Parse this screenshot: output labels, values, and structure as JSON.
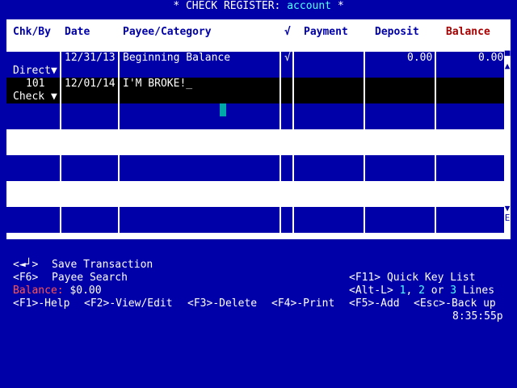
{
  "title": {
    "prefix": "* CHECK REGISTER: ",
    "account": "account",
    "suffix": " *"
  },
  "columns": [
    "Chk/By",
    "Date",
    "Payee/Category",
    "√",
    "Payment",
    "Deposit",
    "Balance"
  ],
  "rows": [
    {
      "num": "",
      "type": "Direct▼",
      "date": "12/31/13",
      "payee": "Beginning Balance",
      "cleared": "√",
      "payment": "",
      "deposit": "0.00",
      "balance": "0.00"
    },
    {
      "num": "101",
      "type": "Check ▼",
      "date": "12/01/14",
      "payee": "I'M BROKE!_",
      "cleared": "",
      "payment": "",
      "deposit": "",
      "balance": ""
    }
  ],
  "scroll": {
    "up": "▲",
    "down": "▼",
    "end": "E",
    "top_mark": "▀"
  },
  "help": {
    "save_key": "<◄┘>",
    "save_label": "Save Transaction",
    "search_key": "<F6>",
    "search_label": "Payee Search",
    "quickkey": "<F11> Quick Key List",
    "lines_key": "<Alt-L>",
    "lines_1": "1",
    "lines_sep1": ", ",
    "lines_2": "2",
    "lines_sep2": " or ",
    "lines_3": "3",
    "lines_label": " Lines",
    "balance_label": "Balance:",
    "balance_value": " $0.00"
  },
  "fkeys": [
    {
      "key": "<F1>",
      "label": "-Help"
    },
    {
      "key": "<F2>",
      "label": "-View/Edit"
    },
    {
      "key": "<F3>",
      "label": "-Delete"
    },
    {
      "key": "<F4>",
      "label": "-Print"
    },
    {
      "key": "<F5>",
      "label": "-Add"
    },
    {
      "key": "<Esc>",
      "label": "-Back up"
    }
  ],
  "clock": "8:35:55p",
  "colors": {
    "background": "#0000a8",
    "panel": "#ffffff",
    "selected_row": "#000000",
    "cursor": "#00a8a8",
    "balance_header": "#a80000"
  }
}
